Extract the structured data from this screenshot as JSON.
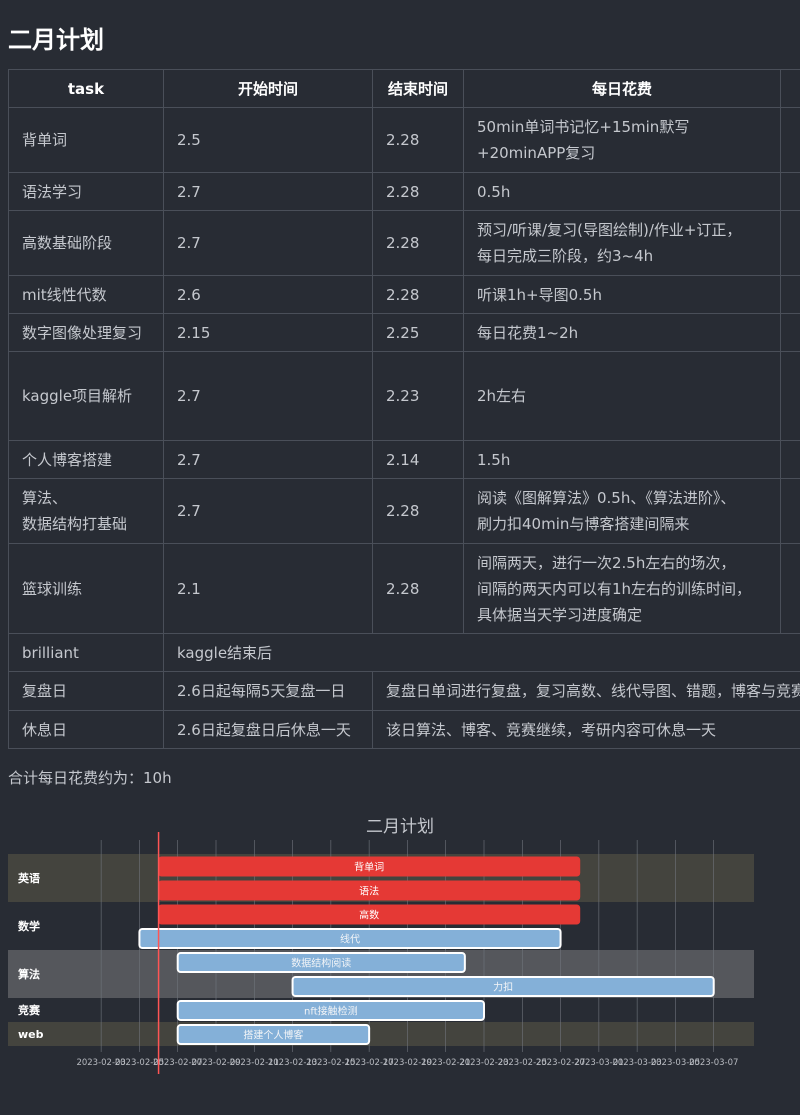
{
  "page": {
    "title": "二月计划"
  },
  "table": {
    "headers": [
      "task",
      "开始时间",
      "结束时间",
      "每日花费"
    ],
    "rows": [
      {
        "task": "背单词",
        "start": "2.5",
        "end": "2.28",
        "cost_lines": [
          "50min单词书记忆+15min默写",
          "+20minAPP复习"
        ]
      },
      {
        "task": "语法学习",
        "start": "2.7",
        "end": "2.28",
        "cost_lines": [
          "0.5h"
        ]
      },
      {
        "task": "高数基础阶段",
        "start": "2.7",
        "end": "2.28",
        "cost_lines": [
          "预习/听课/复习(导图绘制)/作业+订正，",
          "每日完成三阶段，约3~4h"
        ]
      },
      {
        "task": "mit线性代数",
        "start": "2.6",
        "end": "2.28",
        "cost_lines": [
          "听课1h+导图0.5h"
        ]
      },
      {
        "task": "数字图像处理复习",
        "start": "2.15",
        "end": "2.25",
        "cost_lines": [
          "每日花费1~2h"
        ]
      },
      {
        "task": "kaggle项目解析",
        "start": "2.7",
        "end": "2.23",
        "cost_lines": [
          "2h左右"
        ]
      },
      {
        "task": "个人博客搭建",
        "start": "2.7",
        "end": "2.14",
        "cost_lines": [
          "1.5h"
        ]
      },
      {
        "task_lines": [
          "算法、",
          "数据结构打基础"
        ],
        "start": "2.7",
        "end": "2.28",
        "cost_lines": [
          "阅读《图解算法》0.5h、《算法进阶》、",
          "刷力扣40min与博客搭建间隔来"
        ]
      },
      {
        "task": "篮球训练",
        "start": "2.1",
        "end": "2.28",
        "cost_lines": [
          "间隔两天，进行一次2.5h左右的场次，",
          "间隔的两天内可以有1h左右的训练时间，",
          "具体据当天学习进度确定"
        ]
      }
    ],
    "span_rows": [
      {
        "task": "brilliant",
        "text": "kaggle结束后"
      },
      {
        "task": "复盘日",
        "start": "2.6日起每隔5天复盘一日",
        "text": "复盘日单词进行复盘，复习高数、线代导图、错题，博客与竞赛也进行复盘"
      },
      {
        "task": "休息日",
        "start": "2.6日起复盘日后休息一天",
        "text": "该日算法、博客、竞赛继续，考研内容可休息一天"
      }
    ]
  },
  "summary": "合计每日花费约为：10h",
  "chart_data": {
    "type": "gantt",
    "title": "二月计划",
    "x_ticks": [
      "2023-02-03",
      "2023-02-05",
      "2023-02-07",
      "2023-02-09",
      "2023-02-11",
      "2023-02-13",
      "2023-02-15",
      "2023-02-17",
      "2023-02-19",
      "2023-02-21",
      "2023-02-23",
      "2023-02-25",
      "2023-02-27",
      "2023-03-01",
      "2023-03-03",
      "2023-03-05",
      "2023-03-07"
    ],
    "x_range": [
      "2023-02-02",
      "2023-03-09"
    ],
    "today": "2023-02-06",
    "sections": [
      {
        "name": "英语",
        "color": "#44443e",
        "tasks": [
          {
            "name": "背单词",
            "start": "2023-02-06",
            "end": "2023-02-28",
            "color": "#e53935"
          },
          {
            "name": "语法",
            "start": "2023-02-06",
            "end": "2023-02-28",
            "color": "#e53935"
          }
        ]
      },
      {
        "name": "数学",
        "color": "#282c34",
        "tasks": [
          {
            "name": "高数",
            "start": "2023-02-06",
            "end": "2023-02-28",
            "color": "#e53935"
          },
          {
            "name": "线代",
            "start": "2023-02-05",
            "end": "2023-02-27",
            "color": "#84b0d8"
          }
        ]
      },
      {
        "name": "算法",
        "color": "#55575c",
        "tasks": [
          {
            "name": "数据结构阅读",
            "start": "2023-02-07",
            "end": "2023-02-22",
            "color": "#84b0d8"
          },
          {
            "name": "力扣",
            "start": "2023-02-13",
            "end": "2023-03-07",
            "color": "#84b0d8"
          }
        ]
      },
      {
        "name": "竞赛",
        "color": "#282c34",
        "tasks": [
          {
            "name": "nft接触检测",
            "start": "2023-02-07",
            "end": "2023-02-23",
            "color": "#84b0d8"
          }
        ]
      },
      {
        "name": "web",
        "color": "#44443e",
        "tasks": [
          {
            "name": "搭建个人博客",
            "start": "2023-02-07",
            "end": "2023-02-17",
            "color": "#84b0d8"
          }
        ]
      }
    ]
  }
}
